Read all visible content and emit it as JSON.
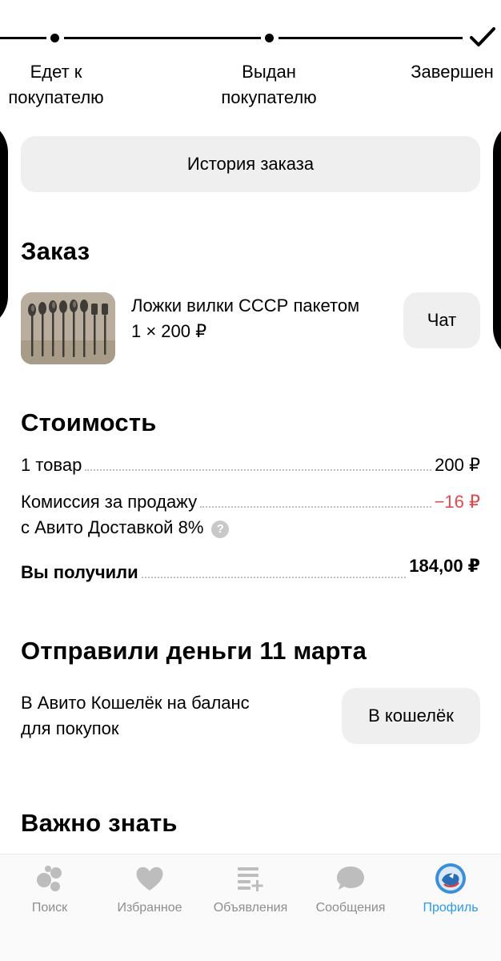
{
  "steps": [
    {
      "label_line1": "Едет к",
      "label_line2": "покупателю"
    },
    {
      "label_line1": "Выдан",
      "label_line2": "покупателю"
    },
    {
      "label_line1": "Завершен",
      "label_line2": ""
    }
  ],
  "history_button": "История заказа",
  "order": {
    "title": "Заказ",
    "item_name": "Ложки вилки СССР пакетом",
    "item_qty_price": "1 × 200 ₽",
    "chat_button": "Чат"
  },
  "cost": {
    "title": "Стоимость",
    "goods_label": "1 товар",
    "goods_value": "200 ₽",
    "commission_label_1": "Комиссия за продажу",
    "commission_label_2": "с Авито Доставкой 8%",
    "commission_help": "?",
    "commission_value": "−16 ₽",
    "received_label": "Вы получили",
    "received_value": "184,00 ₽"
  },
  "payout": {
    "title": "Отправили деньги 11 марта",
    "text_line1": "В Авито Кошелёк на баланс",
    "text_line2": "для покупок",
    "wallet_button": "В кошелёк"
  },
  "important": {
    "title": "Важно знать"
  },
  "tabbar": {
    "items": [
      {
        "label": "Поиск",
        "icon": "search-icon",
        "active": false
      },
      {
        "label": "Избранное",
        "icon": "heart-icon",
        "active": false
      },
      {
        "label": "Объявления",
        "icon": "listings-icon",
        "active": false
      },
      {
        "label": "Сообщения",
        "icon": "messages-icon",
        "active": false
      },
      {
        "label": "Профиль",
        "icon": "profile-avatar-icon",
        "active": true
      }
    ]
  },
  "colors": {
    "accent": "#2b9ae8",
    "negative": "#e04a4f",
    "button_bg": "#efefef",
    "icon_gray": "#bdbdbd"
  }
}
